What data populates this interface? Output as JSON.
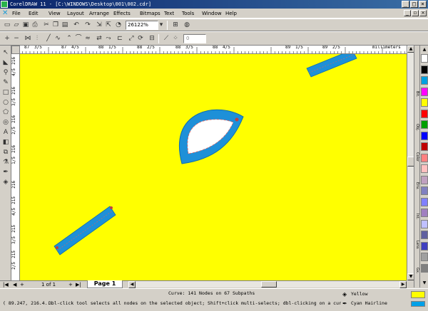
{
  "window": {
    "title": "CorelDRAW 11 - [C:\\WINDOWS\\Desktop\\001\\002.cdr]",
    "btn_min": "_",
    "btn_max": "□",
    "btn_close": "×"
  },
  "menu": {
    "items": [
      "File",
      "Edit",
      "View",
      "Layout",
      "Arrange",
      "Effects",
      "Bitmaps",
      "Text",
      "Tools",
      "Window",
      "Help"
    ]
  },
  "toolbar": {
    "zoom_value": "26122%",
    "nudge_value": "0",
    "angle_value": "0"
  },
  "rulers": {
    "unit": "millimeters",
    "h_ticks": [
      "87",
      "3/5",
      "87",
      "4/5",
      "88",
      "1/5",
      "88",
      "2/5",
      "88",
      "3/5",
      "88",
      "4/5",
      "89",
      "1/5",
      "89",
      "2/5"
    ],
    "v_ticks": [
      "216",
      "4/5",
      "216",
      "3/5",
      "216",
      "2/5",
      "216",
      "1/5",
      "216",
      "215",
      "4/5",
      "215",
      "3/5",
      "215",
      "2/5",
      "215"
    ]
  },
  "pages": {
    "counter": "1 of 1",
    "tab_label": "Page 1"
  },
  "docker_tabs": [
    "Bit.",
    "Obj.",
    "Color",
    "Env.",
    "Int.",
    "Lens",
    "Gx."
  ],
  "palette": [
    "#ffffff",
    "#000000",
    "#00a0e0",
    "#ff00ff",
    "#ffff00",
    "#ff0000",
    "#00a000",
    "#0000ff",
    "#c00000",
    "#ff8080",
    "#ffc0c0",
    "#c0a0c0",
    "#8080c0",
    "#8080ff",
    "#a080c0",
    "#c0c0ff",
    "#6060a0",
    "#4040c0",
    "#a0a0a0",
    "#808080"
  ],
  "status": {
    "object_info": "Curve: 141 Nodes on 67 Subpaths",
    "coordinates": "( 89.247, 216.4...",
    "hint": "Dbl-click tool selects all nodes on the selected object; Shift+click multi-selects; dbl-clicking on a curve adds...",
    "fill_name": "Yellow",
    "outline_name": "Cyan  Hairline",
    "fill_color": "#ffff00",
    "outline_color": "#00a0e8"
  },
  "colors": {
    "canvas": "#ffff00",
    "shape_fill": "#1e90d8",
    "title_bar": "#0a246a"
  }
}
